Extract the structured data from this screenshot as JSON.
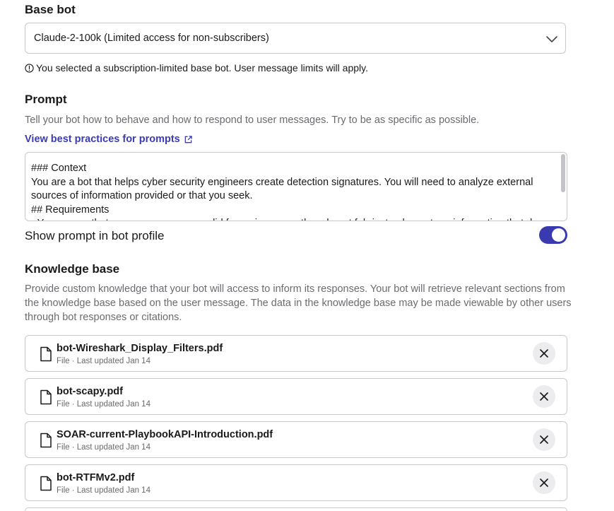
{
  "base_bot": {
    "title": "Base bot",
    "selected": "Claude-2-100k (Limited access for non-subscribers)",
    "notice": "You selected a subscription-limited base bot. User message limits will apply."
  },
  "prompt": {
    "title": "Prompt",
    "description": "Tell your bot how to behave and how to respond to user messages. Try to be as specific as possible.",
    "best_practices_link": "View best practices for prompts",
    "value": "### Context\nYou are a bot that helps cyber security engineers create detection signatures. You will need to analyze external sources of information provided or that you seek.\n## Requirements\n- You ensure that your responses are valid for reviewers so they do not fabricate elements or information that do not exist in the provided sources."
  },
  "show_prompt": {
    "label": "Show prompt in bot profile",
    "enabled": true
  },
  "knowledge_base": {
    "title": "Knowledge base",
    "description": "Provide custom knowledge that your bot will access to inform its responses. Your bot will retrieve relevant sections from the knowledge base based on the user message. The data in the knowledge base may be made viewable by other users through bot responses or citations.",
    "files": [
      {
        "name": "bot-Wireshark_Display_Filters.pdf",
        "meta": "File · Last updated Jan 14"
      },
      {
        "name": "bot-scapy.pdf",
        "meta": "File · Last updated Jan 14"
      },
      {
        "name": "SOAR-current-PlaybookAPI-Introduction.pdf",
        "meta": "File · Last updated Jan 14"
      },
      {
        "name": "bot-RTFMv2.pdf",
        "meta": "File · Last updated Jan 14"
      }
    ]
  },
  "colors": {
    "accent": "#3a3ab0",
    "link": "#3b3bb5",
    "muted_text": "#6b6b70",
    "border": "#c9c9cc"
  },
  "icons": {
    "select_chevron": "chevron-down-icon",
    "notice": "info-circle-icon",
    "external_link": "external-link-icon",
    "file": "file-icon",
    "remove": "close-icon"
  }
}
